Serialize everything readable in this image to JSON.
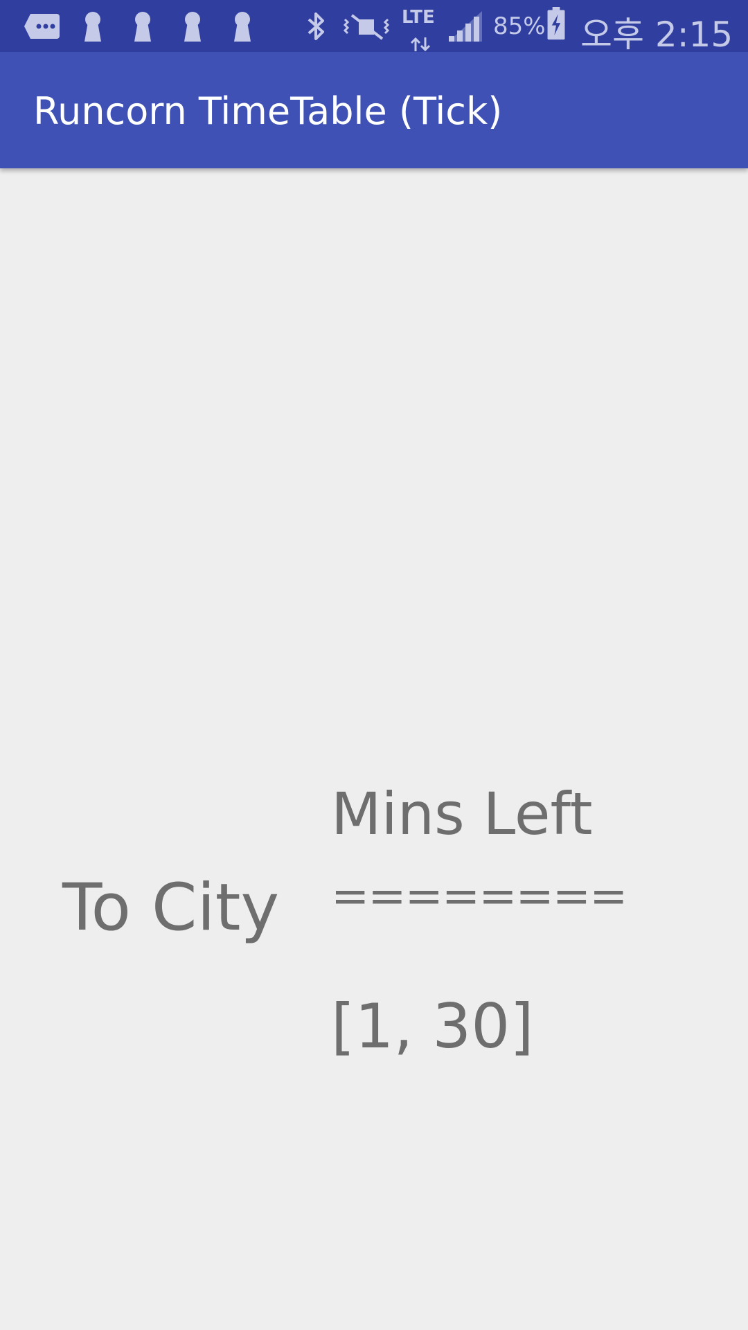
{
  "status_bar": {
    "icons": [
      "message-icon",
      "keyhole-icon",
      "keyhole-icon",
      "keyhole-icon",
      "keyhole-icon",
      "bluetooth-icon",
      "vibrate-mute-icon",
      "lte-data-icon",
      "signal-icon",
      "battery-charging-icon"
    ],
    "network_label": "LTE",
    "battery": "85%",
    "time": "오후 2:15"
  },
  "app_bar": {
    "title": "Runcorn TimeTable (Tick)"
  },
  "main": {
    "direction_label": "To City",
    "column_header": "Mins Left",
    "separator": "========",
    "minutes_left": "[1, 30]"
  },
  "colors": {
    "status_bar": "#303f9f",
    "app_bar": "#3f51b5",
    "background": "#eeeeee",
    "text": "#6e6e6e"
  }
}
